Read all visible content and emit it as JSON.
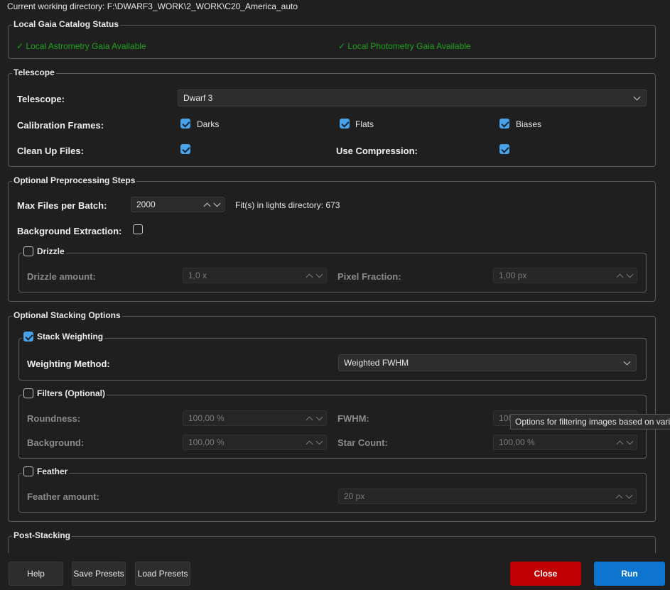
{
  "cwd": "Current working directory: F:\\DWARF3_WORK\\2_WORK\\C20_America_auto",
  "gaia": {
    "title": "Local Gaia Catalog Status",
    "astrometry": "✓ Local Astrometry Gaia Available",
    "photometry": "✓ Local Photometry Gaia Available",
    "status_color": "#21a21f"
  },
  "telescope": {
    "title": "Telescope",
    "telescope_label": "Telescope:",
    "telescope_value": "Dwarf 3",
    "calib_label": "Calibration Frames:",
    "darks": "Darks",
    "flats": "Flats",
    "biases": "Biases",
    "cleanup_label": "Clean Up Files:",
    "compression_label": "Use Compression:"
  },
  "preproc": {
    "title": "Optional Preprocessing Steps",
    "max_files_label": "Max Files per Batch:",
    "max_files_value": "2000",
    "fits_info": "Fit(s) in lights directory: 673",
    "bg_label": "Background Extraction:",
    "drizzle": {
      "title": "Drizzle",
      "amount_label": "Drizzle amount:",
      "amount_value": "1,0 x",
      "pixfrac_label": "Pixel Fraction:",
      "pixfrac_value": "1,00 px"
    }
  },
  "stacking": {
    "title": "Optional Stacking Options",
    "weighting": {
      "title": "Stack Weighting",
      "method_label": "Weighting Method:",
      "method_value": "Weighted FWHM"
    },
    "filters": {
      "title": "Filters (Optional)",
      "roundness_label": "Roundness:",
      "roundness_value": "100,00 %",
      "fwhm_label": "FWHM:",
      "fwhm_value": "100,00 %",
      "background_label": "Background:",
      "background_value": "100,00 %",
      "starcount_label": "Star Count:",
      "starcount_value": "100,00 %"
    },
    "feather": {
      "title": "Feather",
      "amount_label": "Feather amount:",
      "amount_value": "20 px"
    }
  },
  "post": {
    "title": "Post-Stacking"
  },
  "tooltip": "Options for filtering images based on various quality metrics",
  "buttons": {
    "help": "Help",
    "save": "Save Presets",
    "load": "Load Presets",
    "close": "Close",
    "run": "Run"
  },
  "colors": {
    "accent": "#4aa3e8",
    "close": "#c00000",
    "run": "#0d74d0"
  }
}
